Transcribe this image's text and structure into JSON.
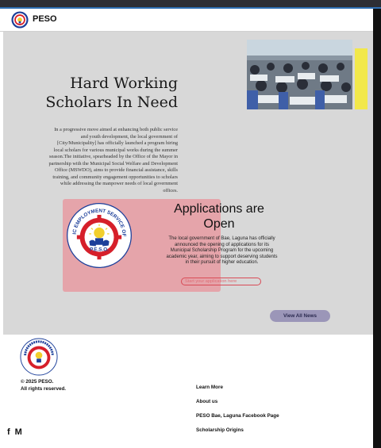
{
  "header": {
    "brand": "PESO"
  },
  "hero": {
    "title_line1": "Hard Working",
    "title_line2": "Scholars In Need",
    "blurb": "In a progressive move aimed at enhancing both public service and youth development, the local government of [City/Municipality] has officially launched a program hiring local scholars for various municipal works during the summer season.The initiative, spearheaded by the Office of the Mayor in partnership with the Municipal Social Welfare and Development Office (MSWDO), aims to provide financial assistance, skills training, and community engagement opportunities to scholars while addressing the manpower needs of local government offices."
  },
  "seal": {
    "arc_text": "PUBLIC EMPLOYMENT SERVICE OFFICE",
    "bottom_text": "P.E.S.O."
  },
  "applications": {
    "title_line1": "Applications are",
    "title_line2": "Open",
    "description": "The local government of Bae, Laguna has officially announced the opening of applications for its Municipal Scholarship Program for the upcoming academic year, aiming to support deserving students in their pursuit of higher education.",
    "start_placeholder": "Start your application here"
  },
  "news": {
    "button_label": "View All News"
  },
  "footer": {
    "copyright_line1": "© 2025 PESO.",
    "copyright_line2": "All rights reserved.",
    "links": [
      "Learn More",
      "About us",
      "PESO Bae, Laguna Facebook Page",
      "Scholarship Origins"
    ],
    "social": [
      {
        "icon": "facebook-icon",
        "glyph": "f"
      },
      {
        "icon": "mail-icon",
        "glyph": "M"
      }
    ]
  },
  "colors": {
    "hero_bg": "#d8d8d8",
    "accent_yellow": "#f2e84a",
    "card_pink": "#e6a0a6",
    "button_lavender": "#9b96b8",
    "seal_red": "#d61f2a",
    "seal_blue": "#1c3f9a"
  }
}
